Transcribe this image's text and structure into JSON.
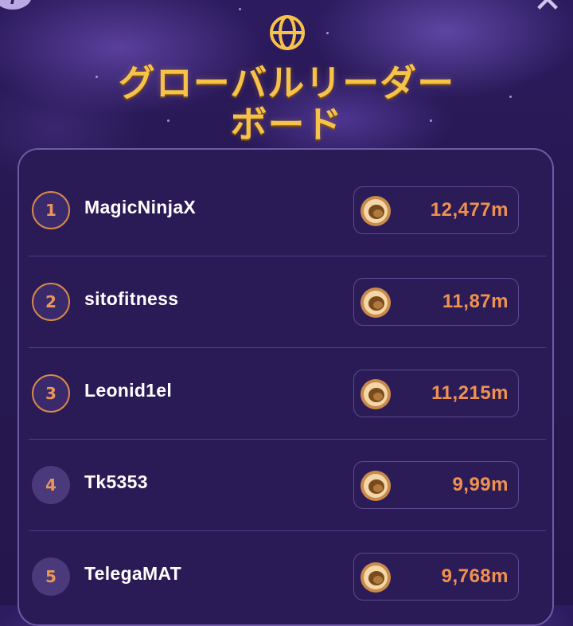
{
  "header": {
    "info_label": "i",
    "close_label": "✕",
    "title_line1": "グローバルリーダー",
    "title_line2": "ボード",
    "title_color": "#f7c24a",
    "icon": "globe-icon"
  },
  "leaderboard": {
    "entries": [
      {
        "rank": "1",
        "name": "MagicNinjaX",
        "score": "12,477m"
      },
      {
        "rank": "2",
        "name": "sitofitness",
        "score": "11,87m"
      },
      {
        "rank": "3",
        "name": "Leonid1el",
        "score": "11,215m"
      },
      {
        "rank": "4",
        "name": "Tk5353",
        "score": "9,99m"
      },
      {
        "rank": "5",
        "name": "TelegaMAT",
        "score": "9,768m"
      }
    ],
    "score_icon": "coin-icon",
    "score_color": "#f0914f"
  }
}
